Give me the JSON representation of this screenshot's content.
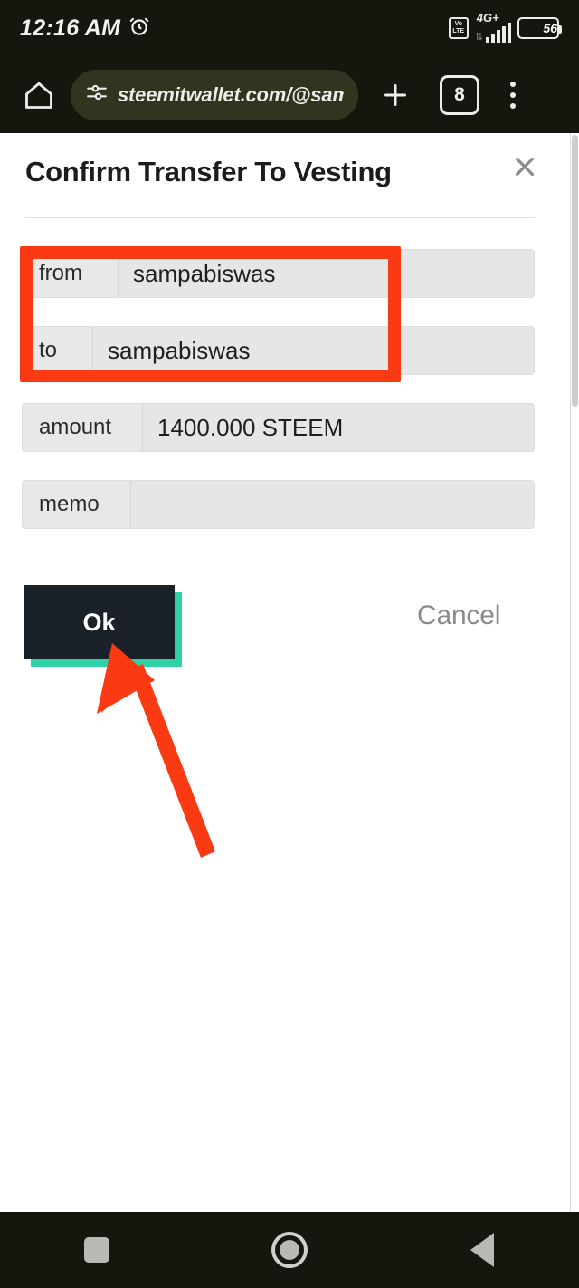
{
  "status_bar": {
    "time": "12:16 AM",
    "alarm_icon": "alarm-clock-icon",
    "volte_line1": "Vo",
    "volte_line2": "LTE",
    "network_type": "4G+",
    "signal_icon": "signal-bars-icon",
    "data_arrows_icon": "data-transfer-icon",
    "battery_percent": "56"
  },
  "browser_bar": {
    "home_icon": "home-icon",
    "site_settings_icon": "tune-icon",
    "url": "steemitwallet.com/@sampabis",
    "new_tab_icon": "plus-icon",
    "tab_count": "8",
    "menu_icon": "kebab-menu-icon"
  },
  "dialog": {
    "title": "Confirm Transfer To Vesting",
    "close_icon": "close-icon",
    "fields": [
      {
        "label": "from",
        "value": "sampabiswas"
      },
      {
        "label": "to",
        "value": "sampabiswas"
      },
      {
        "label": "amount",
        "value": "1400.000 STEEM"
      },
      {
        "label": "memo",
        "value": ""
      }
    ],
    "ok_label": "Ok",
    "cancel_label": "Cancel"
  },
  "annotations": {
    "highlight_box_color": "#f93a13",
    "arrow_color": "#f93a13",
    "arrow_target": "ok-button"
  },
  "theme": {
    "chrome_background": "#13170e",
    "omnibox_background": "#30351f",
    "ok_button_background": "#1b2129",
    "ok_button_shadow": "#2ed3a5",
    "field_background": "#e8e8e8",
    "cancel_text": "#8a8a8a"
  },
  "nav_bar": {
    "recents_icon": "square-recents-icon",
    "home_icon": "circle-home-icon",
    "back_icon": "triangle-back-icon"
  }
}
